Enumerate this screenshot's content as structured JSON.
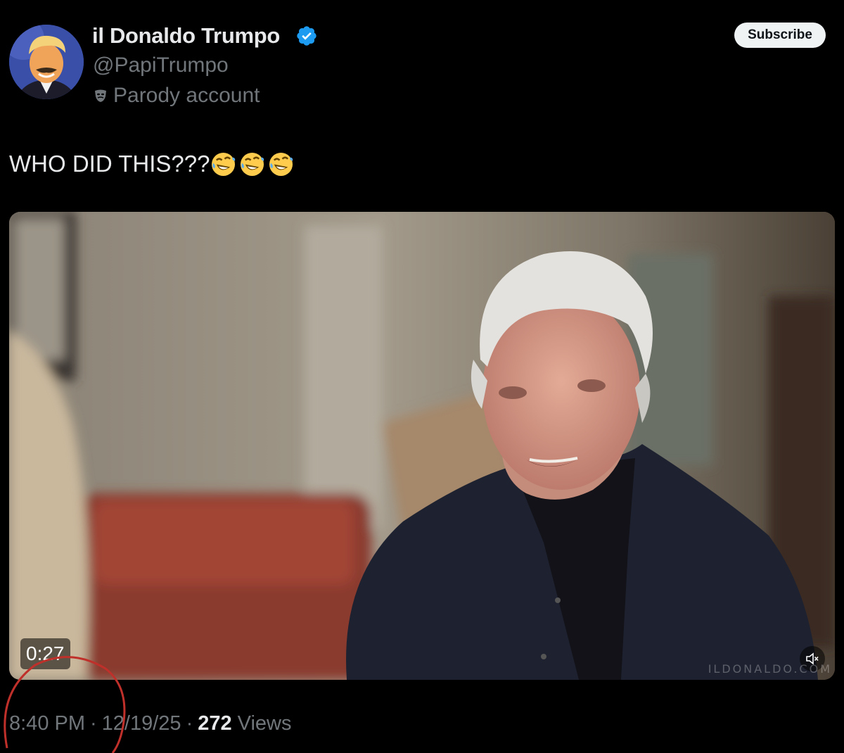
{
  "author": {
    "display_name": "il Donaldo Trumpo",
    "handle": "@PapiTrumpo",
    "label_icon": "theater-masks-icon",
    "label": "Parody account",
    "verified_icon": "verified-badge-icon",
    "verified_color": "#1d9bf0"
  },
  "actions": {
    "subscribe_label": "Subscribe"
  },
  "tweet": {
    "text": "WHO DID THIS???",
    "emoji": [
      "rolling-on-floor-laughing-emoji",
      "rolling-on-floor-laughing-emoji",
      "rolling-on-floor-laughing-emoji"
    ]
  },
  "video": {
    "duration": "0:27",
    "mute_icon": "speaker-muted-icon",
    "watermark": "ILDONALDO.COM"
  },
  "meta": {
    "time": "8:40 PM",
    "date": "12/19/25",
    "separator": "·",
    "views_count": "272",
    "views_label": "Views"
  },
  "annotation": {
    "color": "#c0302b"
  }
}
